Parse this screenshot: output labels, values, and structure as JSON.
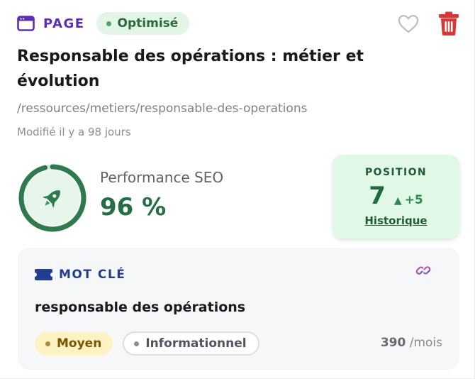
{
  "header": {
    "type_label": "PAGE",
    "status": "Optimisé"
  },
  "page": {
    "title": "Responsable des opérations : métier et évolution",
    "url": "/ressources/metiers/responsable-des-operations",
    "modified": "Modifié il y a 98 jours"
  },
  "performance": {
    "label": "Performance SEO",
    "value_text": "96 %",
    "value": 96
  },
  "position": {
    "label": "POSITION",
    "value": "7",
    "delta": "+5",
    "history_link": "Historique"
  },
  "keyword": {
    "label": "MOT CLÉ",
    "text": "responsable des opérations",
    "difficulty": "Moyen",
    "intent": "Informationnel",
    "volume": "390",
    "volume_unit": "/mois"
  },
  "icons": {
    "page": "browser-window-icon",
    "favorite": "heart-outline-icon",
    "delete": "trash-icon",
    "gauge": "rocket-icon",
    "keyword": "ticket-icon",
    "link": "chain-link-icon"
  },
  "colors": {
    "brand_purple": "#5b2fb3",
    "success_green": "#256d43",
    "danger_red": "#d93636",
    "keyword_blue": "#213f8f"
  }
}
